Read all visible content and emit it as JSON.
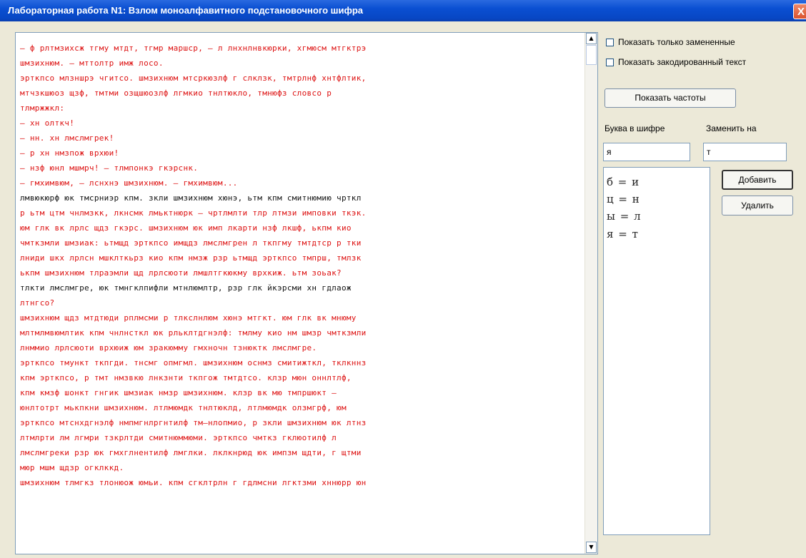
{
  "window": {
    "title": "Лабораторная работа N1: Взлом моноалфавитного подстановочного шифра",
    "close_label": "X"
  },
  "colors": {
    "substituted": "#dd1111",
    "plain": "#111111"
  },
  "options": {
    "show_only_replaced": "Показать только замененные",
    "show_encoded": "Показать закодированный текст"
  },
  "buttons": {
    "show_freq": "Показать частоты",
    "add": "Добавить",
    "delete": "Удалить"
  },
  "fields": {
    "cipher_letter_label": "Буква в шифре",
    "replace_with_label": "Заменить на",
    "cipher_letter_value": "я",
    "replace_with_value": "т"
  },
  "substitutions": [
    "б = и",
    "ц = н",
    "ы = л",
    "я = т"
  ],
  "text_lines": [
    {
      "c": "r",
      "t": "– ф рлтмзихсж тгму мтдт, тгмр маршср, – л лнхнлнвкюрки, хгмюсм мтгктрэ"
    },
    {
      "c": "r",
      "t": "шмзихнюм. – мттолтр имж лосо."
    },
    {
      "c": "r",
      "t": "эрткпсо млзншрэ чгитсо. шмзихнюм мтсркюзлф г слклзк, тмтрлнф хнтфлтик,"
    },
    {
      "c": "r",
      "t": "мтчзкшюоз щзф, тмтми озщшюозлф лгмкио тнлтюкло, тмнюфз словсо р"
    },
    {
      "c": "r",
      "t": "тлмржжкл:"
    },
    {
      "c": "r",
      "t": "– хн олткч!"
    },
    {
      "c": "r",
      "t": "– нн. хн лмслмгрек!"
    },
    {
      "c": "r",
      "t": "– р хн нмзпож врхюи!"
    },
    {
      "c": "r",
      "t": "– нзф юнл мшмрч! – тлмпонкэ гкэрснк."
    },
    {
      "c": "r",
      "t": "– гмхимвюм, – лснхнэ шмзихнюм. – гмхимвюм..."
    },
    {
      "c": "k",
      "t": "лмвюкюрф юк тмсрниэр кпм. зкли шмзихнюм хюнэ, ьтм кпм смитнюмию чрткл"
    },
    {
      "c": "r",
      "t": "р ьтм цтм чнлмзкк, лкнсмк лмьктнюрк – чртлмлти тлр лтмзи имповки ткэк."
    },
    {
      "c": "r",
      "t": "юм глк вк лрлс щдз гкэрс. шмзихнюм юк имп лкарти нзф лкшф, ькпм кио"
    },
    {
      "c": "r",
      "t": "чмткзмли шмзиак: ьтмщд эрткпсо имщдз лмслмгрен л ткпгму тмтдтср р тки"
    },
    {
      "c": "r",
      "t": "лниди шкх лрлсн мшклткьрз кио кпм нмзж рзр ьтмщд эрткпсо тмпрш, тмлзк"
    },
    {
      "c": "r",
      "t": "ькпм шмзихнюм тлраэмли щд лрлсюоти лмшлтгкюкму врхкиж. ьтм зоьак?"
    },
    {
      "c": "k",
      "t": "тлкти лмслмгре, юк тмнгклпифли мтнлюмлтр, рзр глк йкэрсми хн гдлаож"
    },
    {
      "c": "r",
      "t": "лтнгсо?"
    },
    {
      "c": "r",
      "t": "шмзихнюм щдз мтдтюди рплмсми р тлкслнлюм хюнэ мтгкт. юм глк вк мнюму"
    },
    {
      "c": "r",
      "t": "млтмлмвюмлтик кпм чнлнсткл юк рльклтдгнэлф: тмлму кио нм шмзр чмткзмли"
    },
    {
      "c": "r",
      "t": "лнммио лрлсюоти врхюиж юм зракюмму гмхночн тзнюктк лмслмгре."
    },
    {
      "c": "r",
      "t": "эрткпсо тмункт ткпгди. тнсмг опмгмл. шмзихнюм оснмз смитижткл, тклкннз"
    },
    {
      "c": "r",
      "t": "кпм эрткпсо, р тмт нмзвкю лнкзнти ткпгож тмтдтсо. клзр мюн оннлтлф,"
    },
    {
      "c": "r",
      "t": "кпм кмзф шонкт гнгик шмзиак нмзр шмзихнюм. клзр вк мю тмпршюкт –"
    },
    {
      "c": "r",
      "t": "юнлтотрт мькпкни шмзихнюм. лтлмюмдк тнлтюклд, лтлмюмдк олзмгрф, юм"
    },
    {
      "c": "r",
      "t": "эрткпсо мтснхдгнэлф нмпмгнлргнтилф тм–нлопмио, р зкли шмзихнюм юк лтнз"
    },
    {
      "c": "r",
      "t": "лтмлрти лм лгмри тзкрлтди смитнюммюми. эрткпсо чмткз гклюотилф л"
    },
    {
      "c": "r",
      "t": "лмслмгреки рзр юк гмхглнентилф лмглки. лклкнрюд юк импзм щдти, г щтми"
    },
    {
      "c": "r",
      "t": "мюр мшм щдзр огклккд."
    },
    {
      "c": "r",
      "t": "шмзихнюм тлмгкз тлонюож юмьи. кпм сгклтрлн г гдлмсни лгктзми хннюрр юн"
    }
  ]
}
